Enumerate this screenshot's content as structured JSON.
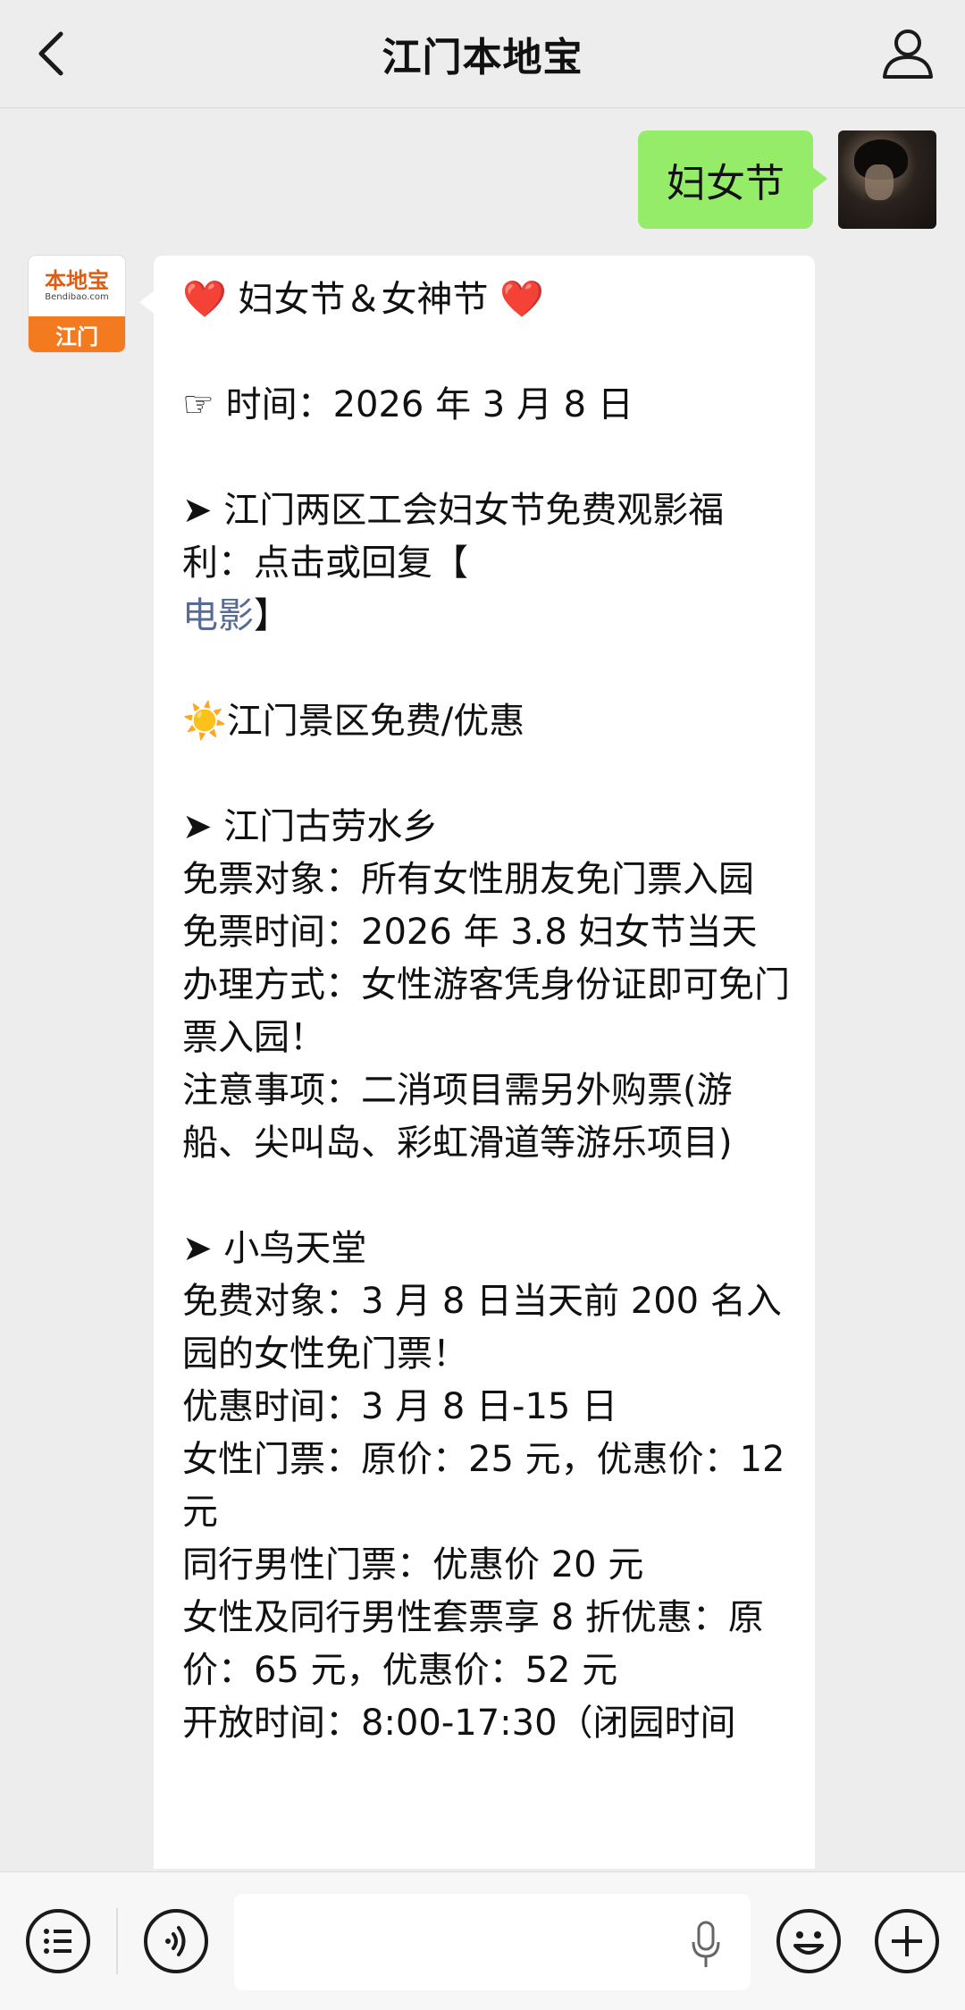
{
  "header": {
    "title": "江门本地宝",
    "back_icon": "chevron-left-icon",
    "profile_icon": "person-icon"
  },
  "chat": {
    "outgoing": {
      "text": "妇女节"
    },
    "bot_avatar": {
      "logo_text": "本地宝",
      "logo_sub": "Bendibao.com",
      "city": "江门"
    },
    "incoming_lines": [
      {
        "type": "rich",
        "parts": [
          {
            "t": "❤️",
            "c": "heart"
          },
          {
            "t": " 妇女节＆女神节 "
          },
          {
            "t": "❤️",
            "c": "heart"
          }
        ]
      },
      {
        "type": "blank"
      },
      {
        "type": "text",
        "t": "☞ 时间：2026 年 3 月 8 日"
      },
      {
        "type": "blank"
      },
      {
        "type": "text",
        "t": "➤ 江门两区工会妇女节免费观影福利：点击或回复【"
      },
      {
        "type": "rich",
        "parts": [
          {
            "t": "电影",
            "c": "link"
          },
          {
            "t": "】"
          }
        ]
      },
      {
        "type": "blank"
      },
      {
        "type": "text",
        "t": "☀️江门景区免费/优惠"
      },
      {
        "type": "blank"
      },
      {
        "type": "text",
        "t": "➤ 江门古劳水乡"
      },
      {
        "type": "text",
        "t": "免票对象：所有女性朋友免门票入园"
      },
      {
        "type": "text",
        "t": "免票时间：2026 年 3.8 妇女节当天"
      },
      {
        "type": "text",
        "t": "办理方式：女性游客凭身份证即可免门票入园！"
      },
      {
        "type": "text",
        "t": "注意事项：二消项目需另外购票(游船、尖叫岛、彩虹滑道等游乐项目)"
      },
      {
        "type": "blank"
      },
      {
        "type": "text",
        "t": "➤ 小鸟天堂"
      },
      {
        "type": "text",
        "t": "免费对象：3 月 8 日当天前 200 名入园的女性免门票！"
      },
      {
        "type": "text",
        "t": "优惠时间：3 月 8 日-15 日"
      },
      {
        "type": "text",
        "t": "女性门票：原价：25 元，优惠价：12 元"
      },
      {
        "type": "text",
        "t": "同行男性门票：优惠价 20 元"
      },
      {
        "type": "text",
        "t": "女性及同行男性套票享 8 折优惠：原价：65 元，优惠价：52 元"
      },
      {
        "type": "text",
        "t": "开放时间：8:00-17:30（闭园时间"
      }
    ]
  },
  "input_bar": {
    "menu_icon": "list-menu-icon",
    "voice_icon": "voice-icon",
    "mic_icon": "microphone-icon",
    "emoji_icon": "emoji-icon",
    "plus_icon": "plus-icon"
  }
}
